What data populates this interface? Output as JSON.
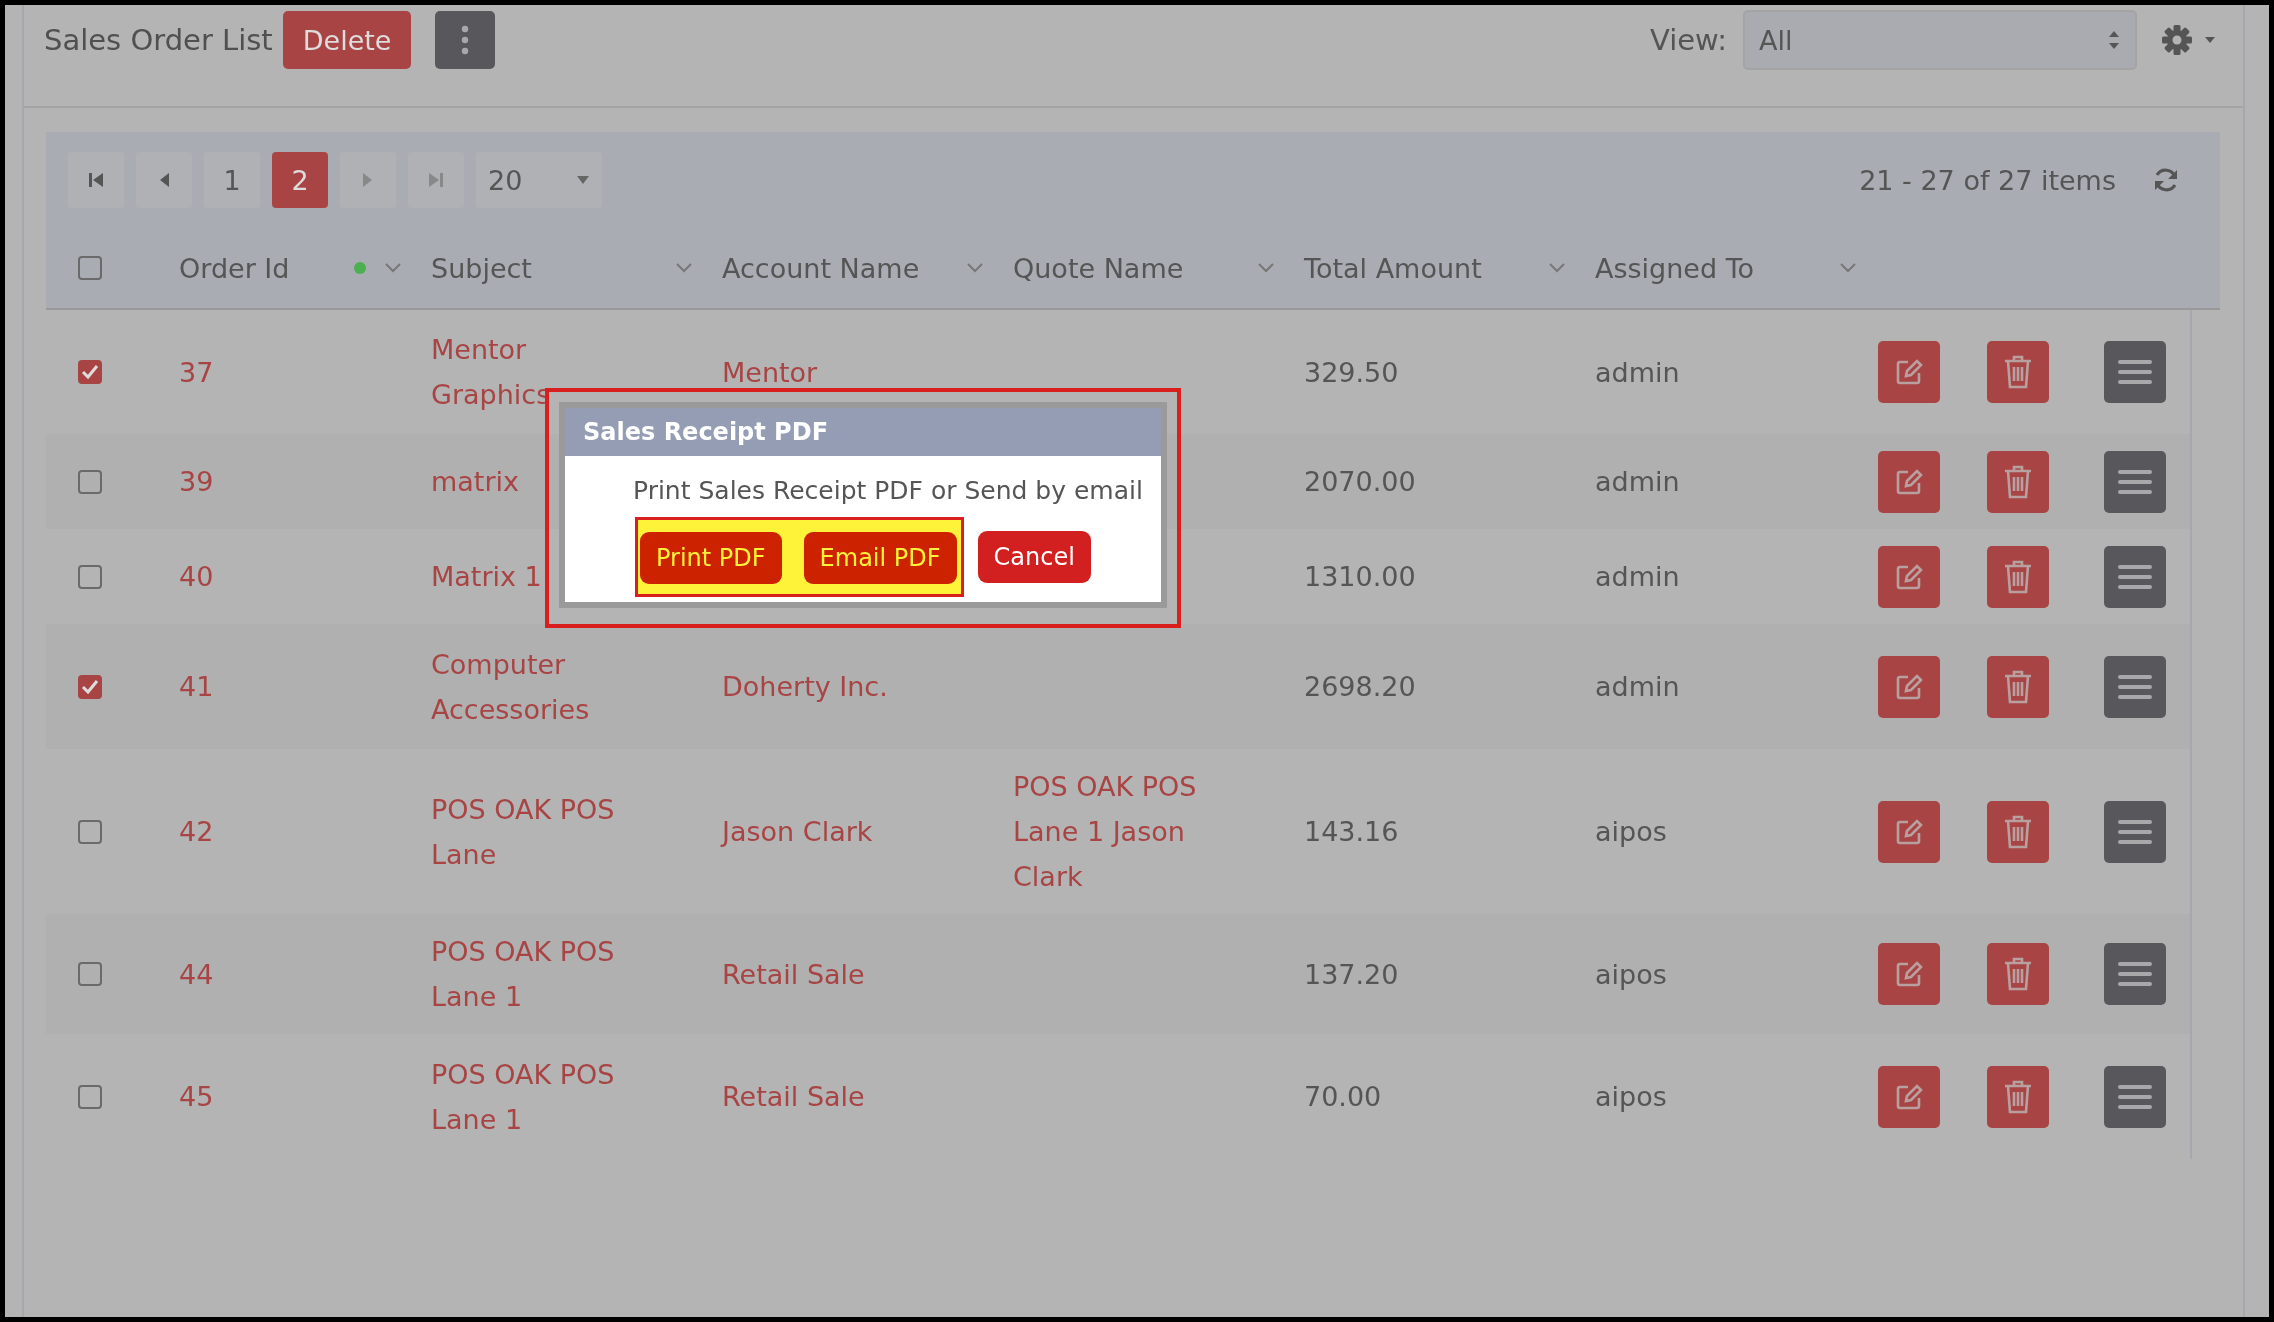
{
  "header": {
    "title": "Sales Order List",
    "delete_button": "Delete",
    "view_label": "View:",
    "view_value": "All"
  },
  "pager": {
    "pages": [
      {
        "label": "1",
        "selected": false
      },
      {
        "label": "2",
        "selected": true
      }
    ],
    "page_size": "20",
    "summary": "21 - 27 of 27 items"
  },
  "table": {
    "select_all_checked": false,
    "columns": [
      "Order Id",
      "Subject",
      "Account Name",
      "Quote Name",
      "Total Amount",
      "Assigned To"
    ],
    "rows": [
      {
        "checked": true,
        "order_id": "37",
        "subject": "Mentor Graphics",
        "account": "Mentor",
        "total": "329.50",
        "assigned": "admin"
      },
      {
        "checked": false,
        "order_id": "39",
        "subject": "matrix",
        "total": "2070.00",
        "assigned": "admin"
      },
      {
        "checked": false,
        "order_id": "40",
        "subject": "Matrix 1",
        "total": "1310.00",
        "assigned": "admin"
      },
      {
        "checked": true,
        "order_id": "41",
        "subject": "Computer Accessories",
        "account": "Doherty Inc.",
        "total": "2698.20",
        "assigned": "admin"
      },
      {
        "checked": false,
        "order_id": "42",
        "subject": "POS OAK POS Lane",
        "account": "Jason Clark",
        "quote": "POS OAK POS Lane 1 Jason Clark",
        "total": "143.16",
        "assigned": "aipos"
      },
      {
        "checked": false,
        "order_id": "44",
        "subject": "POS OAK POS Lane 1",
        "account": "Retail Sale",
        "total": "137.20",
        "assigned": "aipos"
      },
      {
        "checked": false,
        "order_id": "45",
        "subject": "POS OAK POS Lane 1",
        "account": "Retail Sale",
        "total": "70.00",
        "assigned": "aipos"
      }
    ]
  },
  "dialog": {
    "title": "Sales Receipt PDF",
    "message": "Print Sales Receipt PDF or Send by email",
    "buttons": [
      {
        "label": "Print PDF",
        "kind": "highlighted"
      },
      {
        "label": "Email PDF",
        "kind": "highlighted"
      },
      {
        "label": "Cancel",
        "kind": "plain"
      }
    ]
  }
}
